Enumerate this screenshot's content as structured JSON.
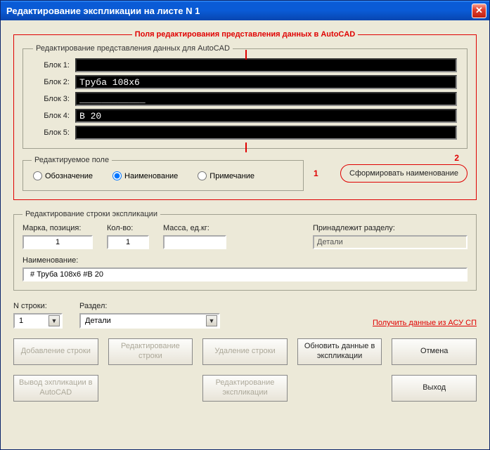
{
  "window": {
    "title": "Редактирование экспликации на листе N 1"
  },
  "fs_red_legend": "Поля редактирования представления данных в AutoCAD",
  "autocad": {
    "legend": "Редактирование представления данных для  AutoCAD",
    "labels": {
      "b1": "Блок 1:",
      "b2": "Блок 2:",
      "b3": "Блок 3:",
      "b4": "Блок 4:",
      "b5": "Блок 5:"
    },
    "values": {
      "b1": "",
      "b2": "Труба 108x6",
      "b3": "____________",
      "b4": "В 20",
      "b5": ""
    }
  },
  "radio": {
    "legend": "Редактируемое поле",
    "options": {
      "desig": "Обозначение",
      "name": "Наименование",
      "note": "Примечание"
    },
    "selected": "name"
  },
  "badges": {
    "one": "1",
    "two": "2"
  },
  "form_name_button": "Сформировать наименование",
  "expl": {
    "legend": "Редактирование строки экспликации",
    "labels": {
      "mark": "Марка, позиция:",
      "qty": "Кол-во:",
      "mass": "Масса, ед.кг:",
      "section": "Принадлежит разделу:",
      "name": "Наименование:"
    },
    "values": {
      "mark": "1",
      "qty": "1",
      "mass": "",
      "section": "Детали",
      "name": " # Труба 108x6 #В 20"
    }
  },
  "bottom": {
    "nstroki_label": "N строки:",
    "nstroki_value": "1",
    "razdel_label": "Раздел:",
    "razdel_value": "Детали",
    "asu_link": "Получить данные из АСУ СП"
  },
  "buttons": {
    "add_row": "Добавление строки",
    "edit_row": "Редактирование строки",
    "del_row": "Удаление строки",
    "refresh": "Обновить данные в экспликации",
    "cancel": "Отмена",
    "to_autocad": "Вывод эхпликации  в AutoCAD",
    "edit_expl": "Редактирование экспликации",
    "exit": "Выход"
  }
}
